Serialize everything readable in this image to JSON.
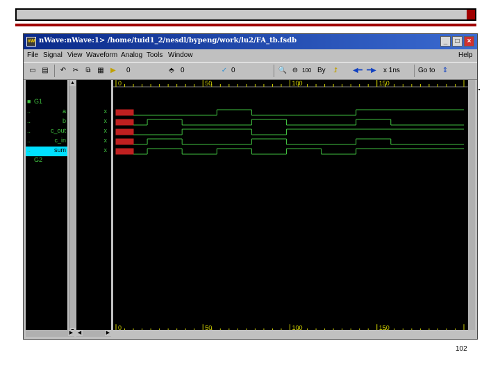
{
  "window": {
    "title": "nWave:nWave:1> /home/tuid1_2/nesdl/bypeng/work/lu2/FA_tb.fsdb",
    "app_icon_text": "nW",
    "controls": [
      "_",
      "□",
      "×"
    ]
  },
  "menu": [
    "File",
    "Signal",
    "View",
    "Waveform",
    "Analog",
    "Tools",
    "Window",
    "Help"
  ],
  "toolbar": {
    "cursor_value": "0",
    "marker_value": "0",
    "delta_value": "0",
    "zoom_100": "100",
    "by_label": "By",
    "time_unit": "x 1ns",
    "goto_label": "Go to"
  },
  "signals": {
    "group_top": "G1",
    "names": [
      "a",
      "b",
      "c_out",
      "c_in",
      "sum"
    ],
    "group_bottom": "G2",
    "values": [
      "x",
      "x",
      "x",
      "x",
      "x"
    ]
  },
  "timeline": {
    "labels": [
      "0",
      "50",
      "100",
      "150"
    ],
    "range": [
      0,
      200
    ]
  },
  "waveforms": [
    {
      "name": "a",
      "edges": [
        [
          0,
          "x"
        ],
        [
          10,
          0
        ],
        [
          58,
          1
        ],
        [
          78,
          0
        ],
        [
          138,
          1
        ]
      ]
    },
    {
      "name": "b",
      "edges": [
        [
          0,
          "x"
        ],
        [
          10,
          0
        ],
        [
          18,
          1
        ],
        [
          38,
          0
        ],
        [
          78,
          1
        ],
        [
          98,
          0
        ],
        [
          138,
          1
        ],
        [
          158,
          0
        ]
      ]
    },
    {
      "name": "c_out",
      "edges": [
        [
          0,
          "x"
        ],
        [
          10,
          0
        ],
        [
          38,
          1
        ],
        [
          78,
          0
        ],
        [
          98,
          1
        ]
      ]
    },
    {
      "name": "c_in",
      "edges": [
        [
          0,
          "x"
        ],
        [
          10,
          0
        ],
        [
          18,
          1
        ],
        [
          38,
          0
        ],
        [
          78,
          1
        ],
        [
          98,
          0
        ],
        [
          138,
          1
        ],
        [
          158,
          0
        ]
      ]
    },
    {
      "name": "sum",
      "edges": [
        [
          0,
          "x"
        ],
        [
          10,
          0
        ],
        [
          18,
          1
        ],
        [
          38,
          0
        ],
        [
          58,
          1
        ],
        [
          78,
          0
        ],
        [
          98,
          1
        ],
        [
          118,
          0
        ],
        [
          138,
          1
        ]
      ]
    }
  ],
  "colors": {
    "wave": "#40c040",
    "unknown": "#c02020",
    "grid": "#d0d000",
    "selected": "#00e0ff"
  },
  "page_number": "102"
}
